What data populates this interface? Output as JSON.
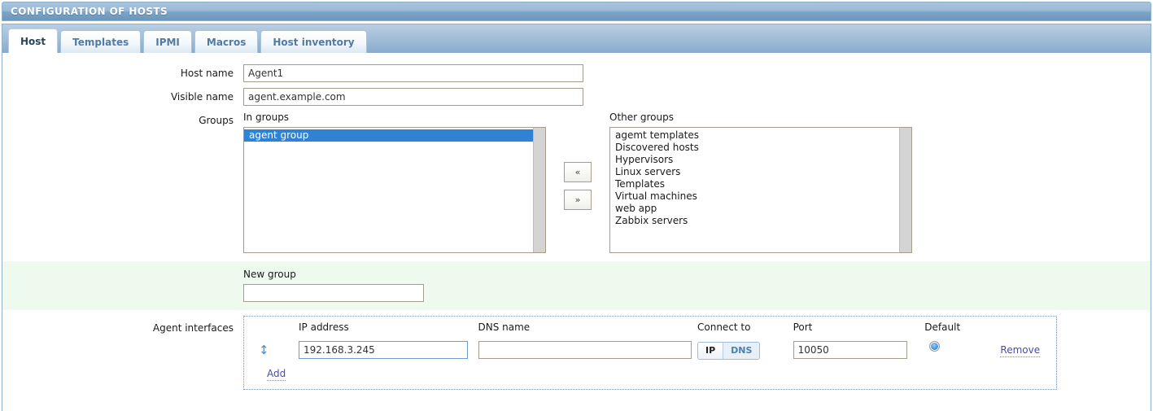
{
  "window": {
    "title": "CONFIGURATION OF HOSTS"
  },
  "tabs": [
    {
      "label": "Host",
      "active": true
    },
    {
      "label": "Templates",
      "active": false
    },
    {
      "label": "IPMI",
      "active": false
    },
    {
      "label": "Macros",
      "active": false
    },
    {
      "label": "Host inventory",
      "active": false
    }
  ],
  "form": {
    "host_name": {
      "label": "Host name",
      "value": "Agent1"
    },
    "visible_name": {
      "label": "Visible name",
      "value": "agent.example.com"
    },
    "groups": {
      "label": "Groups",
      "in_groups_header": "In groups",
      "other_groups_header": "Other groups",
      "in_groups": [
        {
          "label": "agent group",
          "selected": true
        }
      ],
      "other_groups": [
        {
          "label": "agemt templates",
          "selected": false
        },
        {
          "label": "Discovered hosts",
          "selected": false
        },
        {
          "label": "Hypervisors",
          "selected": false
        },
        {
          "label": "Linux servers",
          "selected": false
        },
        {
          "label": "Templates",
          "selected": false
        },
        {
          "label": "Virtual machines",
          "selected": false
        },
        {
          "label": "web app",
          "selected": false
        },
        {
          "label": "Zabbix servers",
          "selected": false
        }
      ],
      "move_left_label": "«",
      "move_right_label": "»"
    },
    "new_group": {
      "label": "New group",
      "value": "",
      "placeholder": ""
    }
  },
  "agent_interfaces": {
    "label": "Agent interfaces",
    "headers": {
      "ip": "IP address",
      "dns": "DNS name",
      "connect_to": "Connect to",
      "port": "Port",
      "default": "Default"
    },
    "rows": [
      {
        "drag_handle_icon": "drag-vertical-icon",
        "ip": "192.168.3.245",
        "ip_focused": true,
        "dns": "",
        "connect_to": {
          "options": [
            "IP",
            "DNS"
          ],
          "selected": "IP"
        },
        "port": "10050",
        "default_selected": true,
        "remove_label": "Remove"
      }
    ],
    "add_label": "Add"
  },
  "colors": {
    "titlebar_top": "#a8c4dd",
    "titlebar_bottom": "#6b97bd",
    "tab_active_text": "#28455f",
    "tab_inactive_text": "#4f7ba6",
    "selection_blue": "#3083d4",
    "new_group_band": "#eefaee",
    "link_purple": "#4b4ba8",
    "focus_border": "#6f9dc8"
  }
}
